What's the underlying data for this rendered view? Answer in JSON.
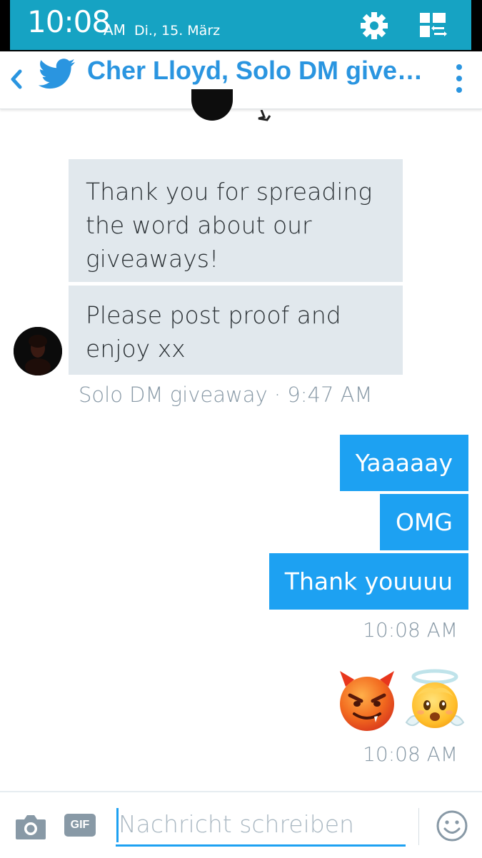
{
  "status_bar": {
    "time": "10:08",
    "ampm": "AM",
    "date": "Di., 15. März",
    "settings_icon": "gear-icon",
    "quick_settings_icon": "quick-settings-icon",
    "color": "#16a3c3"
  },
  "header": {
    "back_icon": "chevron-left-icon",
    "logo_icon": "twitter-bird-icon",
    "title": "Cher Lloyd, Solo DM give…",
    "menu_icon": "more-vertical-icon",
    "accent": "#2a95e0"
  },
  "conversation": {
    "incoming": [
      {
        "text": "Thank you for spreading the word about our giveaways!"
      },
      {
        "text": "Please post proof and enjoy xx"
      }
    ],
    "incoming_meta": "Solo DM giveaway · 9:47 AM",
    "outgoing": [
      {
        "text": "Yaaaaay"
      },
      {
        "text": "OMG"
      },
      {
        "text": "Thank youuuu"
      }
    ],
    "outgoing_meta_1": "10:08 AM",
    "emojis": [
      "smiling-devil-emoji",
      "angel-emoji"
    ],
    "outgoing_meta_2": "10:08 AM",
    "incoming_color": "#e1e8ed",
    "outgoing_color": "#1da1f2"
  },
  "composer": {
    "camera_icon": "camera-icon",
    "gif_label": "GIF",
    "placeholder": "Nachricht schreiben",
    "emoji_icon": "smiley-icon"
  }
}
